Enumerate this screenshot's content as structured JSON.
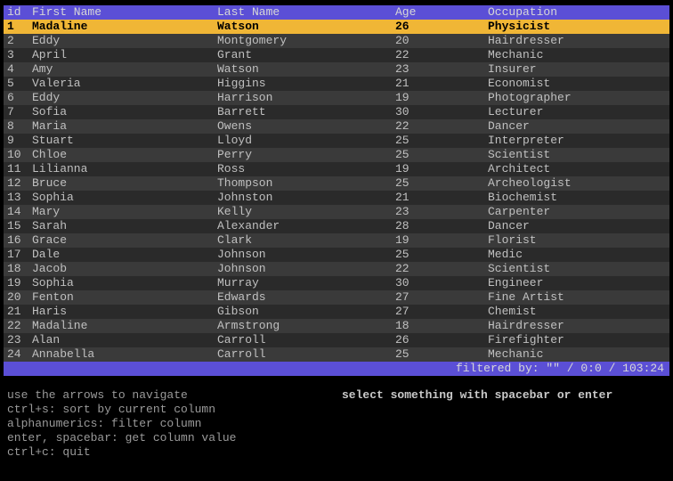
{
  "header": {
    "id": "id",
    "first_name": "First Name",
    "last_name": "Last Name",
    "age": "Age",
    "occupation": "Occupation"
  },
  "rows": [
    {
      "id": "1",
      "first_name": "Madaline",
      "last_name": "Watson",
      "age": "26",
      "occupation": "Physicist",
      "selected": true
    },
    {
      "id": "2",
      "first_name": "Eddy",
      "last_name": "Montgomery",
      "age": "20",
      "occupation": "Hairdresser",
      "selected": false
    },
    {
      "id": "3",
      "first_name": "April",
      "last_name": "Grant",
      "age": "22",
      "occupation": "Mechanic",
      "selected": false
    },
    {
      "id": "4",
      "first_name": "Amy",
      "last_name": "Watson",
      "age": "23",
      "occupation": "Insurer",
      "selected": false
    },
    {
      "id": "5",
      "first_name": "Valeria",
      "last_name": "Higgins",
      "age": "21",
      "occupation": "Economist",
      "selected": false
    },
    {
      "id": "6",
      "first_name": "Eddy",
      "last_name": "Harrison",
      "age": "19",
      "occupation": "Photographer",
      "selected": false
    },
    {
      "id": "7",
      "first_name": "Sofia",
      "last_name": "Barrett",
      "age": "30",
      "occupation": "Lecturer",
      "selected": false
    },
    {
      "id": "8",
      "first_name": "Maria",
      "last_name": "Owens",
      "age": "22",
      "occupation": "Dancer",
      "selected": false
    },
    {
      "id": "9",
      "first_name": "Stuart",
      "last_name": "Lloyd",
      "age": "25",
      "occupation": "Interpreter",
      "selected": false
    },
    {
      "id": "10",
      "first_name": "Chloe",
      "last_name": "Perry",
      "age": "25",
      "occupation": "Scientist",
      "selected": false
    },
    {
      "id": "11",
      "first_name": "Lilianna",
      "last_name": "Ross",
      "age": "19",
      "occupation": "Architect",
      "selected": false
    },
    {
      "id": "12",
      "first_name": "Bruce",
      "last_name": "Thompson",
      "age": "25",
      "occupation": "Archeologist",
      "selected": false
    },
    {
      "id": "13",
      "first_name": "Sophia",
      "last_name": "Johnston",
      "age": "21",
      "occupation": "Biochemist",
      "selected": false
    },
    {
      "id": "14",
      "first_name": "Mary",
      "last_name": "Kelly",
      "age": "23",
      "occupation": "Carpenter",
      "selected": false
    },
    {
      "id": "15",
      "first_name": "Sarah",
      "last_name": "Alexander",
      "age": "28",
      "occupation": "Dancer",
      "selected": false
    },
    {
      "id": "16",
      "first_name": "Grace",
      "last_name": "Clark",
      "age": "19",
      "occupation": "Florist",
      "selected": false
    },
    {
      "id": "17",
      "first_name": "Dale",
      "last_name": "Johnson",
      "age": "25",
      "occupation": "Medic",
      "selected": false
    },
    {
      "id": "18",
      "first_name": "Jacob",
      "last_name": "Johnson",
      "age": "22",
      "occupation": "Scientist",
      "selected": false
    },
    {
      "id": "19",
      "first_name": "Sophia",
      "last_name": "Murray",
      "age": "30",
      "occupation": "Engineer",
      "selected": false
    },
    {
      "id": "20",
      "first_name": "Fenton",
      "last_name": "Edwards",
      "age": "27",
      "occupation": "Fine Artist",
      "selected": false
    },
    {
      "id": "21",
      "first_name": "Haris",
      "last_name": "Gibson",
      "age": "27",
      "occupation": "Chemist",
      "selected": false
    },
    {
      "id": "22",
      "first_name": "Madaline",
      "last_name": "Armstrong",
      "age": "18",
      "occupation": "Hairdresser",
      "selected": false
    },
    {
      "id": "23",
      "first_name": "Alan",
      "last_name": "Carroll",
      "age": "26",
      "occupation": "Firefighter",
      "selected": false
    },
    {
      "id": "24",
      "first_name": "Annabella",
      "last_name": "Carroll",
      "age": "25",
      "occupation": "Mechanic",
      "selected": false
    }
  ],
  "status": "filtered by: \"\" / 0:0 / 103:24",
  "help": {
    "left": [
      "use the arrows to navigate",
      "ctrl+s: sort by current column",
      "alphanumerics: filter column",
      "enter, spacebar: get column value",
      "ctrl+c: quit"
    ],
    "right": "select something with spacebar or enter"
  }
}
